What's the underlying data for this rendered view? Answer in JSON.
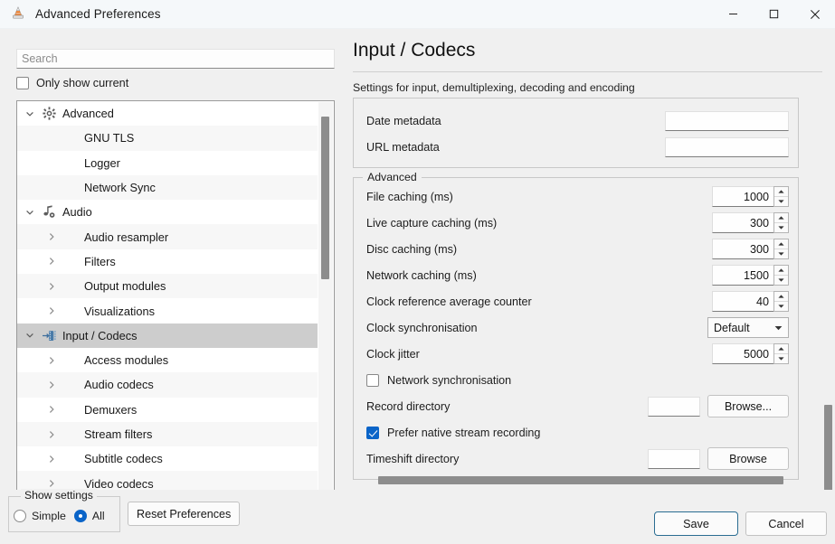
{
  "window": {
    "title": "Advanced Preferences",
    "app_icon": "vlc-cone-icon",
    "minimize_label": "Minimize",
    "maximize_label": "Maximize",
    "close_label": "Close"
  },
  "sidebar": {
    "search": {
      "placeholder": "Search",
      "value": ""
    },
    "only_show_current": {
      "label": "Only show current",
      "checked": false
    },
    "tree": [
      {
        "label": "Advanced",
        "level": 1,
        "twisty": "expanded",
        "icon": "gear-icon",
        "selected": false
      },
      {
        "label": "GNU TLS",
        "level": 2,
        "twisty": "none",
        "icon": "none",
        "selected": false
      },
      {
        "label": "Logger",
        "level": 2,
        "twisty": "none",
        "icon": "none",
        "selected": false
      },
      {
        "label": "Network Sync",
        "level": 2,
        "twisty": "none",
        "icon": "none",
        "selected": false
      },
      {
        "label": "Audio",
        "level": 1,
        "twisty": "expanded",
        "icon": "audio-note-icon",
        "selected": false
      },
      {
        "label": "Audio resampler",
        "level": 2,
        "twisty": "collapsed",
        "icon": "none",
        "selected": false
      },
      {
        "label": "Filters",
        "level": 2,
        "twisty": "collapsed",
        "icon": "none",
        "selected": false
      },
      {
        "label": "Output modules",
        "level": 2,
        "twisty": "collapsed",
        "icon": "none",
        "selected": false
      },
      {
        "label": "Visualizations",
        "level": 2,
        "twisty": "collapsed",
        "icon": "none",
        "selected": false
      },
      {
        "label": "Input / Codecs",
        "level": 1,
        "twisty": "expanded",
        "icon": "input-codecs-icon",
        "selected": true
      },
      {
        "label": "Access modules",
        "level": 2,
        "twisty": "collapsed",
        "icon": "none",
        "selected": false
      },
      {
        "label": "Audio codecs",
        "level": 2,
        "twisty": "collapsed",
        "icon": "none",
        "selected": false
      },
      {
        "label": "Demuxers",
        "level": 2,
        "twisty": "collapsed",
        "icon": "none",
        "selected": false
      },
      {
        "label": "Stream filters",
        "level": 2,
        "twisty": "collapsed",
        "icon": "none",
        "selected": false
      },
      {
        "label": "Subtitle codecs",
        "level": 2,
        "twisty": "collapsed",
        "icon": "none",
        "selected": false
      },
      {
        "label": "Video codecs",
        "level": 2,
        "twisty": "collapsed",
        "icon": "none",
        "selected": false
      }
    ]
  },
  "panel": {
    "title": "Input / Codecs",
    "subtitle": "Settings for input, demultiplexing, decoding and encoding",
    "metadata_group": {
      "fields": [
        {
          "label": "Date metadata",
          "value": ""
        },
        {
          "label": "URL metadata",
          "value": ""
        }
      ]
    },
    "advanced_group": {
      "legend": "Advanced",
      "spinners": [
        {
          "label": "File caching (ms)",
          "value": "1000"
        },
        {
          "label": "Live capture caching (ms)",
          "value": "300"
        },
        {
          "label": "Disc caching (ms)",
          "value": "300"
        },
        {
          "label": "Network caching (ms)",
          "value": "1500"
        },
        {
          "label": "Clock reference average counter",
          "value": "40"
        }
      ],
      "clock_sync": {
        "label": "Clock synchronisation",
        "value": "Default"
      },
      "clock_jitter": {
        "label": "Clock jitter",
        "value": "5000"
      },
      "network_sync": {
        "label": "Network synchronisation",
        "checked": false
      },
      "record_directory": {
        "label": "Record directory",
        "value": "",
        "browse_label": "Browse..."
      },
      "prefer_native": {
        "label": "Prefer native stream recording",
        "checked": true
      },
      "timeshift_directory": {
        "label": "Timeshift directory",
        "value": "",
        "browse_label": "Browse"
      }
    }
  },
  "bottom": {
    "show_settings_legend": "Show settings",
    "radio_simple": {
      "label": "Simple",
      "selected": false
    },
    "radio_all": {
      "label": "All",
      "selected": true
    },
    "reset_label": "Reset Preferences",
    "save_label": "Save",
    "cancel_label": "Cancel"
  },
  "colors": {
    "accent": "#0a64c8",
    "titlebar_bg": "#f5f8fa",
    "window_bg": "#f0f0f0",
    "selection_bg": "#cdcdcd",
    "scrollbar_thumb": "#8d8d8d",
    "save_focus_border": "#2a6d92"
  }
}
